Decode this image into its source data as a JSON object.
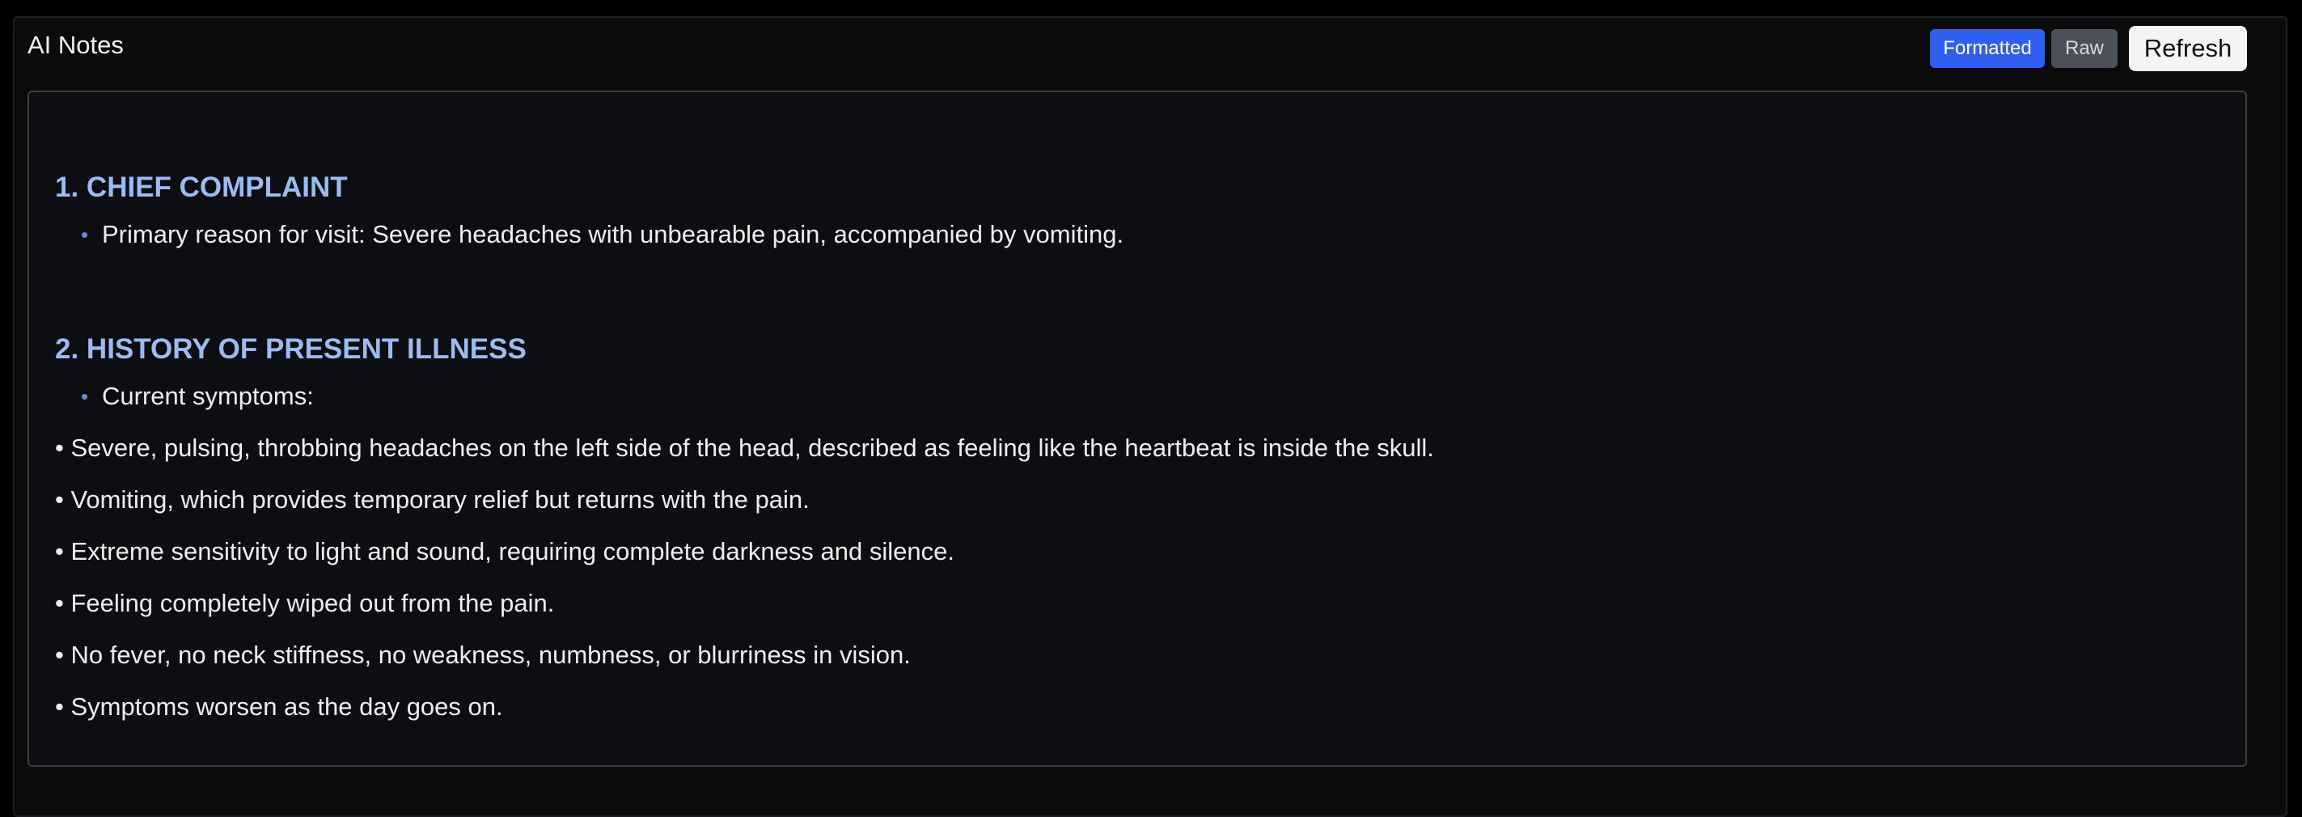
{
  "panel": {
    "title": "AI Notes"
  },
  "toolbar": {
    "formatted_label": "Formatted",
    "raw_label": "Raw",
    "refresh_label": "Refresh"
  },
  "notes": {
    "sections": [
      {
        "heading": "1. CHIEF COMPLAINT",
        "bullet": "Primary reason for visit: Severe headaches with unbearable pain, accompanied by vomiting."
      },
      {
        "heading": "2. HISTORY OF PRESENT ILLNESS",
        "bullet": "Current symptoms:",
        "lines": [
          "• Severe, pulsing, throbbing headaches on the left side of the head, described as feeling like the heartbeat is inside the skull.",
          "• Vomiting, which provides temporary relief but returns with the pain.",
          "• Extreme sensitivity to light and sound, requiring complete darkness and silence.",
          "• Feeling completely wiped out from the pain.",
          "• No fever, no neck stiffness, no weakness, numbness, or blurriness in vision.",
          "• Symptoms worsen as the day goes on."
        ]
      }
    ]
  },
  "colors": {
    "accent": "#2f5ff0",
    "heading": "#9bbcf2",
    "bullet": "#5b8fe0",
    "background": "#0b0b0b"
  }
}
